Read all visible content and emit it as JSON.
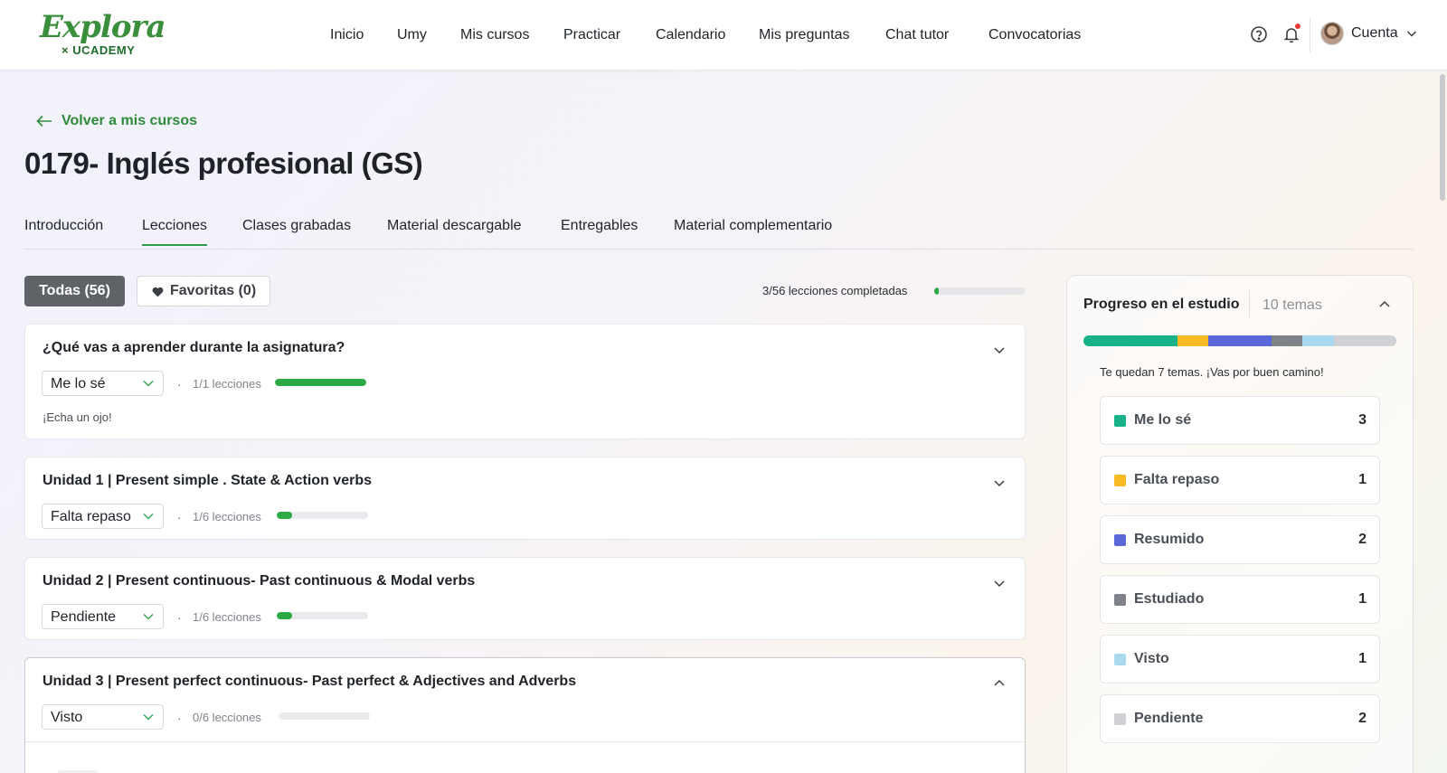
{
  "logo": {
    "main": "Explora",
    "sub": "× UCADEMY"
  },
  "nav": {
    "items": [
      "Inicio",
      "Umy",
      "Mis cursos",
      "Practicar",
      "Calendario",
      "Mis preguntas",
      "Chat tutor",
      "Convocatorias"
    ],
    "account_label": "Cuenta"
  },
  "header": {
    "back_label": "Volver a mis cursos",
    "title": "0179- Inglés profesional (GS)"
  },
  "tabs": [
    "Introducción",
    "Lecciones",
    "Clases grabadas",
    "Material descargable",
    "Entregables",
    "Material complementario"
  ],
  "active_tab": "Lecciones",
  "filters": {
    "all_label": "Todas (56)",
    "fav_label": "Favoritas (0)",
    "overall_progress_text": "3/56 lecciones completadas",
    "overall_progress_fraction": 0.054
  },
  "units": [
    {
      "title": "¿Qué vas a aprender durante la asignatura?",
      "status": "Me lo sé",
      "lessons": "1/1 lecciones",
      "progress": 1.0,
      "note": "¡Echa un ojo!",
      "expanded": false
    },
    {
      "title": "Unidad 1 | Present simple . State & Action verbs",
      "status": "Falta repaso",
      "lessons": "1/6 lecciones",
      "progress": 0.167,
      "note": "",
      "expanded": false
    },
    {
      "title": "Unidad 2 | Present continuous- Past continuous & Modal verbs",
      "status": "Pendiente",
      "lessons": "1/6 lecciones",
      "progress": 0.167,
      "note": "",
      "expanded": false
    },
    {
      "title": "Unidad 3 | Present perfect continuous- Past perfect & Adjectives and Adverbs",
      "status": "Visto",
      "lessons": "0/6 lecciones",
      "progress": 0.0,
      "note": "",
      "expanded": true
    }
  ],
  "study_progress": {
    "title": "Progreso en el estudio",
    "subtitle": "10 temas",
    "message": "Te quedan 7 temas. ¡Vas por buen camino!",
    "categories": [
      {
        "label": "Me lo sé",
        "count": "3",
        "value": 3,
        "color": "#17b287"
      },
      {
        "label": "Falta repaso",
        "count": "1",
        "value": 1,
        "color": "#f7b924"
      },
      {
        "label": "Resumido",
        "count": "2",
        "value": 2,
        "color": "#5a67d8"
      },
      {
        "label": "Estudiado",
        "count": "1",
        "value": 1,
        "color": "#7f8288"
      },
      {
        "label": "Visto",
        "count": "1",
        "value": 1,
        "color": "#a9d8ef"
      },
      {
        "label": "Pendiente",
        "count": "2",
        "value": 2,
        "color": "#cfd1d4"
      }
    ]
  },
  "icons": {
    "help": "help-circle-icon",
    "notifications": "bell-icon",
    "back": "arrow-left-icon",
    "favorite": "heart-icon",
    "expand": "chevron-down-icon",
    "collapse": "chevron-up-icon"
  }
}
